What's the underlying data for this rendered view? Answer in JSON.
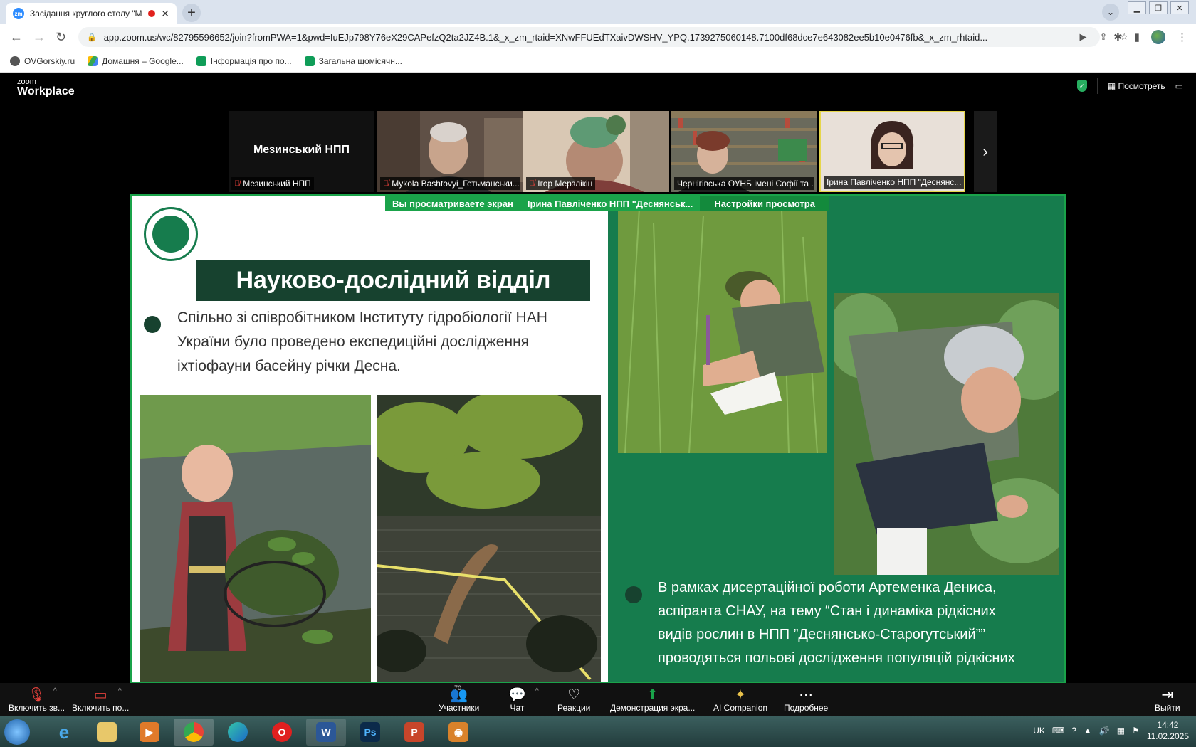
{
  "browser": {
    "tab_title": "Засідання круглого столу \"М",
    "tab_favicon": "zm",
    "url": "app.zoom.us/wc/82795596652/join?fromPWA=1&pwd=IuEJp798Y76eX29CAPefzQ2ta2JZ4B.1&_x_zm_rtaid=XNwFFUEdTXaivDWSHV_YPQ.1739275060148.7100df68dce7e643082ee5b10e0476fb&_x_zm_rhtaid...",
    "bookmarks": [
      {
        "label": "OVGorskiy.ru",
        "icon": "globe-icon"
      },
      {
        "label": "Домашня – Google...",
        "icon": "drive-icon"
      },
      {
        "label": "Інформація про по...",
        "icon": "sheets-icon"
      },
      {
        "label": "Загальна щомісячн...",
        "icon": "sheets-icon"
      }
    ]
  },
  "zoom": {
    "logo_small": "zoom",
    "logo_big": "Workplace",
    "view_button": "Посмотреть",
    "participants_strip": [
      {
        "name": "Мезинський НПП",
        "big_label": "Мезинський НПП",
        "muted": true
      },
      {
        "name": "Mykola Bashtovyi_Гетьманськи...",
        "muted": true
      },
      {
        "name": "Ігор Мерзлікін",
        "muted": true
      },
      {
        "name": "Чернігівська ОУНБ імені Софії та ...",
        "muted": false
      },
      {
        "name": "Ірина Павліченко НПП \"Деснянс...",
        "muted": false,
        "active": true
      }
    ],
    "share_banner": {
      "text": "Вы просматриваете экран",
      "presenter": "Ірина Павліченко НПП \"Деснянськ...",
      "settings": "Настройки просмотра"
    },
    "slide": {
      "heading": "Науково-дослідний відділ",
      "bullet1": [
        "Спільно зі співробітником Інституту гідробіології НАН",
        "України було проведено експедиційні дослідження",
        "іхтіофауни басейну річки Десна."
      ],
      "bullet2": [
        "В рамках дисертаційної роботи Артеменка Дениса,",
        "аспіранта СНАУ, на тему “Стан і динаміка рідкісних",
        "видів рослин в НПП ”Деснянсько-Старогутський””",
        "проводяться польові дослідження популяцій рідкісних"
      ]
    },
    "toolbar": {
      "audio": "Включить зв...",
      "video": "Включить по...",
      "participants": "Участники",
      "participants_count": "70",
      "chat": "Чат",
      "reactions": "Реакции",
      "share": "Демонстрация экра...",
      "ai": "AI Companion",
      "more": "Подробнее",
      "leave": "Выйти"
    }
  },
  "taskbar": {
    "lang": "UK",
    "time": "14:42",
    "date": "11.02.2025"
  },
  "colors": {
    "zoom_green": "#1aa34a",
    "slide_dark_green": "#17422f",
    "slide_panel_green": "#167c4d"
  }
}
